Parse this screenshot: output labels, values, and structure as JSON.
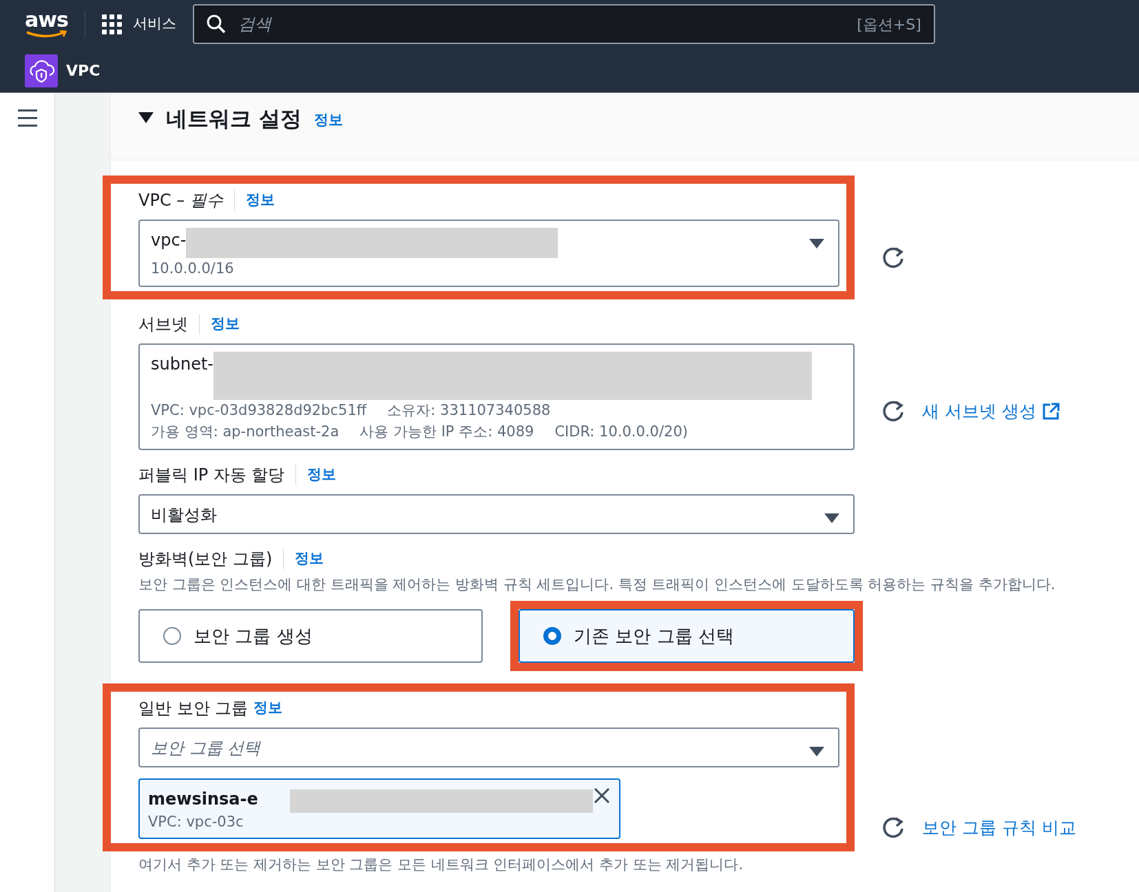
{
  "top_nav": {
    "logo": "aws",
    "services": "서비스",
    "search": {
      "placeholder": "검색",
      "shortcut": "[옵션+S]"
    }
  },
  "service_bar": {
    "name": "VPC"
  },
  "section": {
    "title": "네트워크 설정",
    "info": "정보",
    "expanded": true
  },
  "fields": [
    {
      "kind": "select",
      "label": "VPC – *필수*",
      "info": "정보",
      "info_separator": true,
      "value": "vpc-",
      "redacted": true,
      "highlighted": true,
      "refresh": true,
      "detail_lines": [
        [
          "10.0.0.0/16"
        ]
      ]
    },
    {
      "kind": "select",
      "label": "서브넷",
      "info": "정보",
      "info_separator": true,
      "value": "subnet-",
      "redacted": true,
      "highlighted": false,
      "refresh": true,
      "tall": true,
      "detail_lines": [
        [
          "VPC: vpc-03d93828d92bc51ff",
          "소유자: 331107340588"
        ],
        [
          "가용 영역: ap-northeast-2a",
          "사용 가능한 IP 주소: 4089",
          "CIDR: 10.0.0.0/20)"
        ]
      ],
      "side_link": {
        "label": "새 서브넷 생성",
        "external": true
      }
    },
    {
      "kind": "select",
      "label": "퍼블릭 IP 자동 할당",
      "info": "정보",
      "info_separator": true,
      "value": "비활성화",
      "redacted": false,
      "highlighted": false,
      "refresh": false
    },
    {
      "kind": "radio-cards",
      "label": "방화벽(보안 그룹)",
      "info": "정보",
      "info_separator": true,
      "description": "보안 그룹은 인스턴스에 대한 트래픽을 제어하는 방화벽 규칙 세트입니다. 특정 트래픽이 인스턴스에 도달하도록 허용하는 규칙을 추가합니다.",
      "options": [
        {
          "label": "보안 그룹 생성",
          "selected": false,
          "highlighted": false
        },
        {
          "label": "기존 보안 그룹 선택",
          "selected": true,
          "highlighted": true
        }
      ]
    },
    {
      "kind": "multi-select",
      "label": "일반 보안 그룹",
      "info": "정보",
      "info_separator": false,
      "placeholder": "보안 그룹 선택",
      "highlighted": true,
      "refresh": true,
      "tokens": [
        {
          "name": "mewsinsa-e",
          "detail": "VPC: vpc-03c",
          "redacted": true
        }
      ],
      "side_link": {
        "label": "보안 그룹 규칙 비교",
        "external": false
      },
      "footer": "여기서 추가 또는 제거하는 보안 그룹은 모든 네트워크 인터페이스에서 추가 또는 제거됩니다."
    }
  ]
}
